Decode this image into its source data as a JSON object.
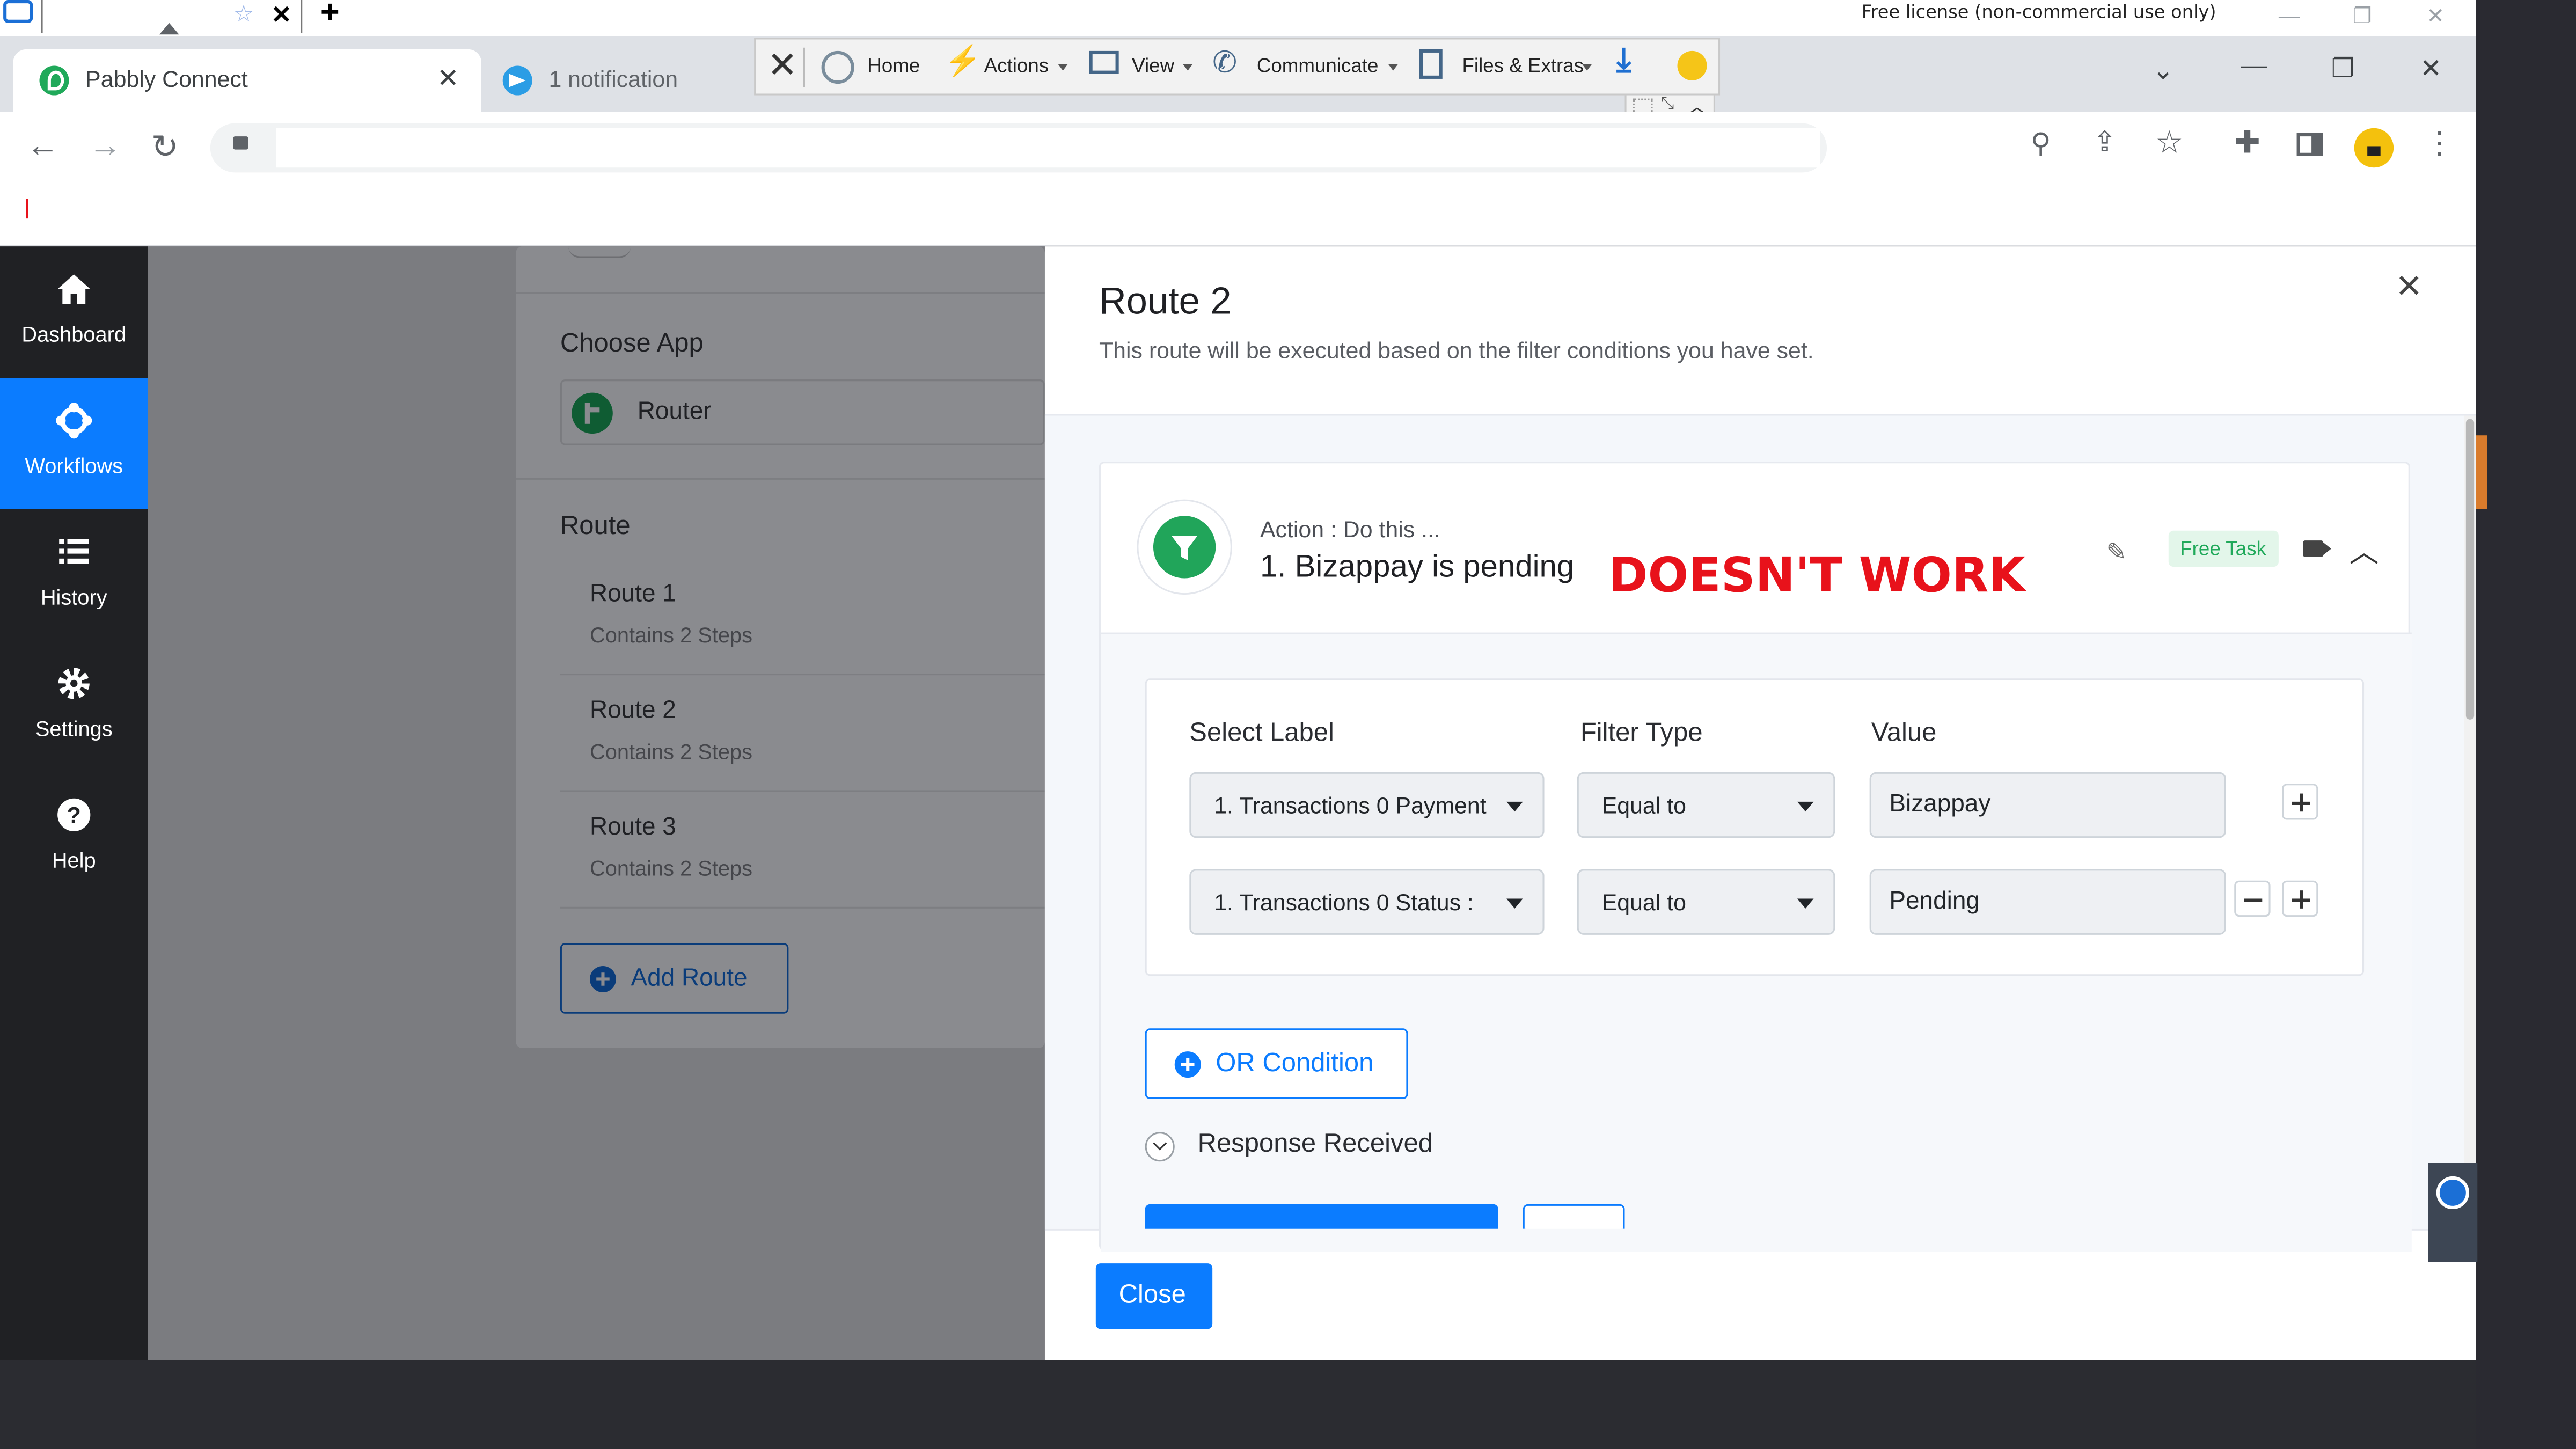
{
  "teamviewer": {
    "license_text": "Free license (non-commercial use only)",
    "toolbar": [
      "Home",
      "Actions",
      "View",
      "Communicate",
      "Files & Extras"
    ]
  },
  "browser": {
    "tabs": [
      {
        "label": "Pabbly Connect",
        "active": true
      },
      {
        "label": "1 notification",
        "active": false
      }
    ]
  },
  "sidebar": {
    "items": [
      {
        "label": "Dashboard",
        "icon": "home-icon",
        "active": false
      },
      {
        "label": "Workflows",
        "icon": "workflow-icon",
        "active": true
      },
      {
        "label": "History",
        "icon": "list-icon",
        "active": false
      },
      {
        "label": "Settings",
        "icon": "gear-icon",
        "active": false
      },
      {
        "label": "Help",
        "icon": "help-icon",
        "active": false
      }
    ]
  },
  "left_panel": {
    "choose_app_label": "Choose App",
    "app_name": "Router",
    "route_heading": "Route",
    "routes": [
      {
        "name": "Route 1",
        "steps": "Contains 2 Steps"
      },
      {
        "name": "Route 2",
        "steps": "Contains 2 Steps"
      },
      {
        "name": "Route 3",
        "steps": "Contains 2 Steps"
      }
    ],
    "add_route_label": "Add Route"
  },
  "modal": {
    "title": "Route 2",
    "subtitle": "This route will be executed based on the filter conditions you have set.",
    "action_prefix": "Action : Do this ...",
    "action_title": "1. Bizappay is pending",
    "annotation": "DOESN'T WORK",
    "badge": "Free Task",
    "columns": {
      "label": "Select Label",
      "filter": "Filter Type",
      "value": "Value"
    },
    "rows": [
      {
        "label": "1. Transactions 0 Payment",
        "filter": "Equal to",
        "value": "Bizappay"
      },
      {
        "label": "1. Transactions 0 Status :",
        "filter": "Equal to",
        "value": "Pending"
      }
    ],
    "or_condition_label": "OR Condition",
    "response_received_label": "Response Received",
    "close_label": "Close"
  },
  "colors": {
    "accent": "#0b7cff",
    "annotation_red": "#e8121b",
    "badge_bg": "#e3f6ea",
    "badge_text": "#20a95a",
    "filter_icon_green": "#21a55a"
  }
}
